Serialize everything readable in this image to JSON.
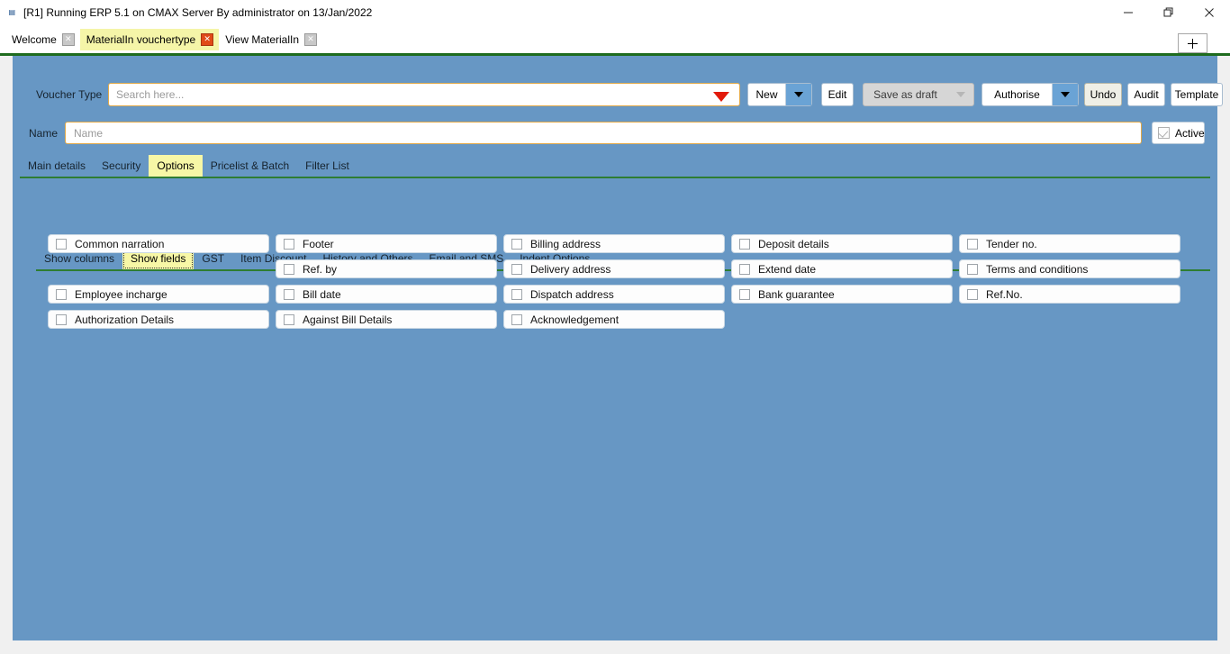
{
  "window": {
    "title": "[R1] Running ERP 5.1 on CMAX Server By administrator on 13/Jan/2022",
    "app_icon": "erp-app-icon",
    "minimize_label": "minimize-icon",
    "maximize_label": "restore-icon",
    "close_label": "close-icon"
  },
  "tabstrip": {
    "tabs": [
      {
        "label": "Welcome",
        "active": false,
        "close": "✕"
      },
      {
        "label": "MaterialIn vouchertype",
        "active": true,
        "close": "✕"
      },
      {
        "label": "View MaterialIn",
        "active": false,
        "close": "✕"
      }
    ],
    "new_tab_label": "+"
  },
  "toolbar": {
    "voucher_type_label": "Voucher Type",
    "search_placeholder": "Search here...",
    "search_value": "",
    "buttons": [
      {
        "label": "New",
        "has_arrow": true,
        "state": "normal"
      },
      {
        "label": "Edit",
        "has_arrow": false,
        "state": "normal"
      },
      {
        "label": "Save as draft",
        "has_arrow": true,
        "state": "disabled"
      },
      {
        "label": "Authorise",
        "has_arrow": true,
        "state": "normal"
      },
      {
        "label": "Undo",
        "has_arrow": false,
        "state": "hover"
      },
      {
        "label": "Audit",
        "has_arrow": false,
        "state": "normal"
      },
      {
        "label": "Template",
        "has_arrow": false,
        "state": "normal"
      }
    ]
  },
  "name_row": {
    "label": "Name",
    "placeholder": "Name",
    "value": "",
    "active_label": "Active",
    "active_checked": true,
    "active_disabled": true
  },
  "main_tabs": [
    {
      "label": "Main details",
      "active": false
    },
    {
      "label": "Security",
      "active": false
    },
    {
      "label": "Options",
      "active": true
    },
    {
      "label": "Pricelist & Batch",
      "active": false
    },
    {
      "label": "Filter List",
      "active": false
    }
  ],
  "sub_tabs": [
    {
      "label": "Show columns",
      "active": false
    },
    {
      "label": "Show fields",
      "active": true
    },
    {
      "label": "GST",
      "active": false
    },
    {
      "label": "Item Discount",
      "active": false
    },
    {
      "label": "History and Others",
      "active": false
    },
    {
      "label": "Email and SMS",
      "active": false
    },
    {
      "label": "Indent Options",
      "active": false
    }
  ],
  "field_columns": [
    {
      "items": [
        {
          "label": "Common narration",
          "checked": false,
          "row": 0
        },
        {
          "label": "Employee incharge",
          "checked": false,
          "row": 2
        },
        {
          "label": "Authorization Details",
          "checked": false,
          "row": 3
        }
      ]
    },
    {
      "items": [
        {
          "label": "Footer",
          "checked": false,
          "row": 0
        },
        {
          "label": "Ref. by",
          "checked": false,
          "row": 1
        },
        {
          "label": "Bill date",
          "checked": false,
          "row": 2
        },
        {
          "label": "Against Bill Details",
          "checked": false,
          "row": 3
        }
      ]
    },
    {
      "items": [
        {
          "label": "Billing address",
          "checked": false,
          "row": 0
        },
        {
          "label": "Delivery address",
          "checked": false,
          "row": 1
        },
        {
          "label": "Dispatch address",
          "checked": false,
          "row": 2
        },
        {
          "label": "Acknowledgement",
          "checked": false,
          "row": 3
        }
      ]
    },
    {
      "items": [
        {
          "label": "Deposit details",
          "checked": false,
          "row": 0
        },
        {
          "label": "Extend date",
          "checked": false,
          "row": 1
        },
        {
          "label": "Bank guarantee",
          "checked": false,
          "row": 2
        }
      ]
    },
    {
      "items": [
        {
          "label": "Tender no.",
          "checked": false,
          "row": 0
        },
        {
          "label": "Terms and conditions",
          "checked": false,
          "row": 1
        },
        {
          "label": "Ref.No.",
          "checked": false,
          "row": 2
        }
      ]
    }
  ],
  "colors": {
    "panel_blue": "#6797c4",
    "accent_green": "#2e7d32",
    "highlight_yellow": "#f7f7a6",
    "field_border_orange": "#e0a94a",
    "dropdown_red": "#e21b0c"
  }
}
